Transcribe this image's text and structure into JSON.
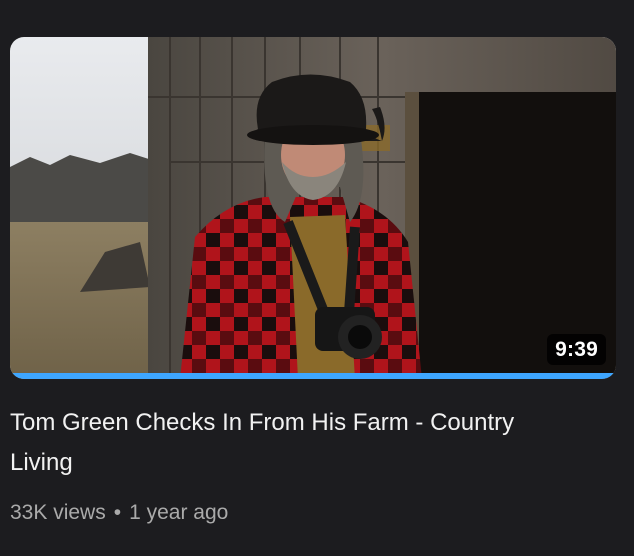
{
  "video": {
    "title": "Tom Green Checks In From His Farm - Country Living",
    "duration": "9:39",
    "views": "33K views",
    "separator": "•",
    "age": "1 year ago",
    "watch_progress": 1.0
  },
  "colors": {
    "background": "#1c1c1f",
    "title_text": "#f1f1f1",
    "meta_text": "#aaaaaa",
    "progress_bar": "#3ea6ff"
  },
  "thumbnail": {
    "scene": "man-in-cowboy-hat-and-red-plaid-jacket-by-barn-icon"
  }
}
